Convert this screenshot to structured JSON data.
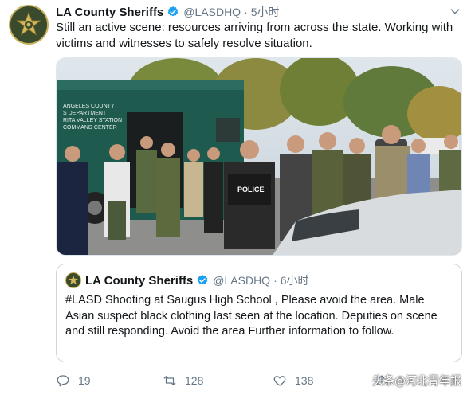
{
  "tweet": {
    "author_name": "LA County Sheriffs",
    "handle": "@LASDHQ",
    "separator": "·",
    "time": "5小时",
    "text": "Still an active scene: resources arriving from across the state.  Working with victims and witnesses to safely resolve situation.",
    "verified_icon": "verified-badge-icon",
    "menu_icon": "chevron-down-icon"
  },
  "media": {
    "van_lines": [
      "ANGELES COUNTY",
      "S DEPARTMENT",
      "RITA VALLEY STATION",
      "COMMAND CENTER"
    ],
    "vest_label": "POLICE"
  },
  "quoted_tweet": {
    "author_name": "LA County Sheriffs",
    "handle": "@LASDHQ",
    "separator": "·",
    "time": "6小时",
    "text": "#LASD Shooting at Saugus High School , Please avoid the area. Male Asian suspect black clothing last seen at the location. Deputies on scene and still responding.  Avoid the area Further information to follow."
  },
  "actions": {
    "reply_count": "19",
    "retweet_count": "128",
    "like_count": "138",
    "reply_icon": "reply-icon",
    "retweet_icon": "retweet-icon",
    "like_icon": "heart-icon",
    "share_icon": "share-icon"
  },
  "watermark": "头条@河北青年报",
  "colors": {
    "verified": "#1da1f2",
    "secondary_text": "#657786",
    "van_green": "#1f5a4f"
  }
}
